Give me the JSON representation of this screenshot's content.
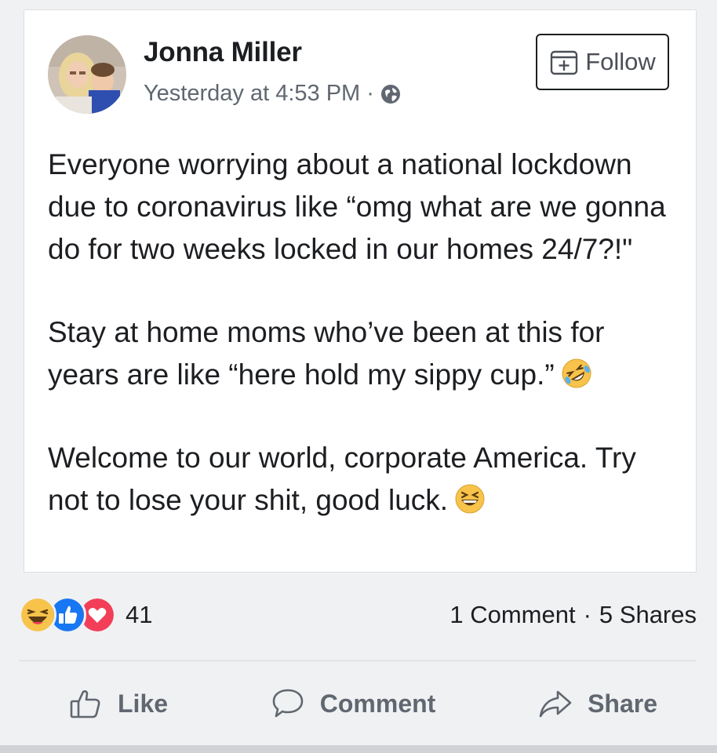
{
  "post": {
    "author": "Jonna Miller",
    "timestamp": "Yesterday at 4:53 PM",
    "separator": "·",
    "privacy_icon": "globe-icon",
    "follow_label": "Follow",
    "follow_icon": "follow-add-icon",
    "paragraphs": [
      "Everyone worrying about a national lockdown due to coronavirus like “omg what are we gonna do for two weeks locked in our homes 24/7?!\"",
      "Stay at home moms who’ve been at this for years are like “here hold my sippy cup.”",
      "Welcome to our world, corporate America. Try not to lose your shit, good luck."
    ],
    "paragraph_emojis": [
      "",
      "rolling-on-floor-laughing-emoji",
      "grinning-squinting-emoji"
    ]
  },
  "stats": {
    "reaction_icons": [
      "haha-reaction-icon",
      "like-reaction-icon",
      "love-reaction-icon"
    ],
    "reaction_count": "41",
    "comments": "1 Comment",
    "separator": "·",
    "shares": "5 Shares"
  },
  "actions": {
    "like": "Like",
    "comment": "Comment",
    "share": "Share"
  },
  "colors": {
    "text": "#1c1e21",
    "secondary_text": "#606770",
    "like_blue": "#1877f2",
    "love_red": "#f33e58",
    "haha_yellow": "#f7c34a"
  }
}
